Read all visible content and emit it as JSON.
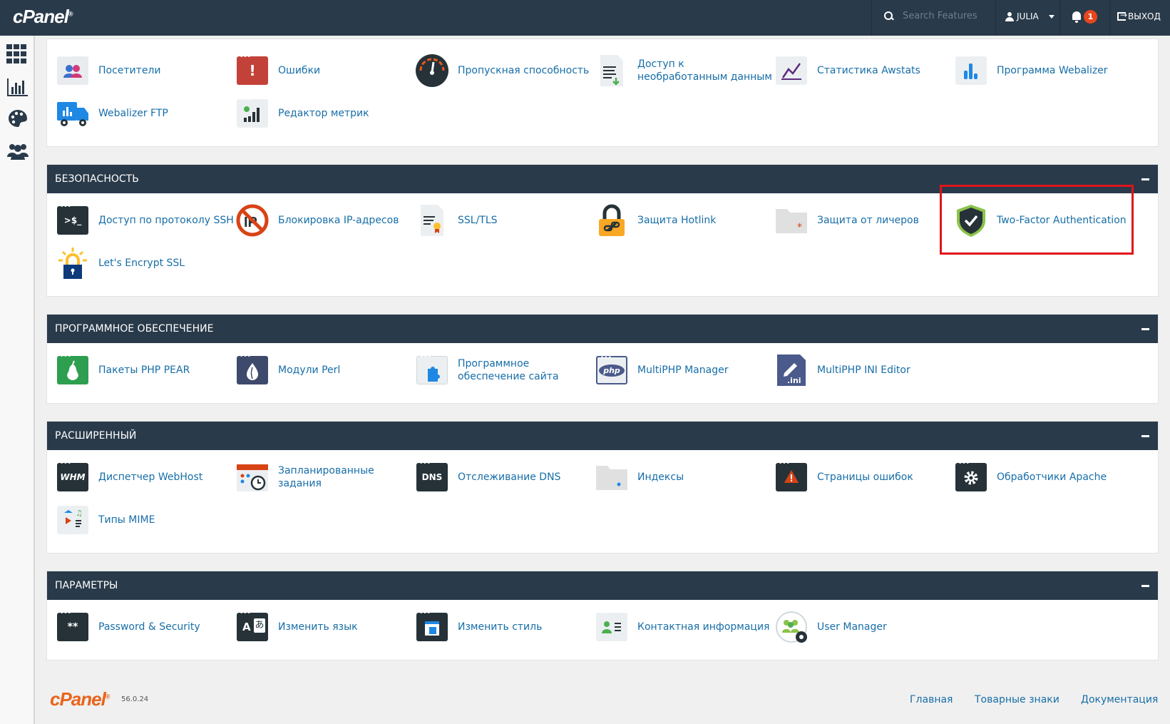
{
  "topbar": {
    "logo": "cPanel",
    "search_placeholder": "Search Features",
    "user": "JULIA",
    "notifications": "1",
    "logout": "ВЫХОД"
  },
  "metrics": {
    "items": [
      "Посетители",
      "Ошибки",
      "Пропускная способность",
      "Доступ к необработанным данным",
      "Статистика Awstats",
      "Программа Webalizer",
      "Webalizer FTP",
      "Редактор метрик"
    ]
  },
  "security": {
    "title": "БЕЗОПАСНОСТЬ",
    "items": [
      "Доступ по протоколу SSH",
      "Блокировка IP-адресов",
      "SSL/TLS",
      "Защита Hotlink",
      "Защита от личеров",
      "Two-Factor Authentication",
      "Let's Encrypt SSL"
    ]
  },
  "software": {
    "title": "ПРОГРАММНОЕ ОБЕСПЕЧЕНИЕ",
    "items": [
      "Пакеты PHP PEAR",
      "Модули Perl",
      "Программное обеспечение сайта",
      "MultiPHP Manager",
      "MultiPHP INI Editor"
    ]
  },
  "advanced": {
    "title": "РАСШИРЕННЫЙ",
    "items": [
      "Диспетчер WebHost",
      "Запланированные задания",
      "Отслеживание DNS",
      "Индексы",
      "Страницы ошибок",
      "Обработчики Apache",
      "Типы MIME"
    ]
  },
  "preferences": {
    "title": "ПАРАМЕТРЫ",
    "items": [
      "Password & Security",
      "Изменить язык",
      "Изменить стиль",
      "Контактная информация",
      "User Manager"
    ]
  },
  "footer": {
    "logo": "cPanel",
    "version": "56.0.24",
    "links": [
      "Главная",
      "Товарные знаки",
      "Документация"
    ]
  },
  "icon_text": {
    "ssh": ">$_",
    "dns": "DNS",
    "whm": "WHM",
    "php": "php",
    "ini": ".ini",
    "password": "**",
    "lang": "A"
  },
  "colors": {
    "header": "#293a4a",
    "link": "#176ea8",
    "highlight": "#e0131c",
    "badge": "#e8461d"
  }
}
